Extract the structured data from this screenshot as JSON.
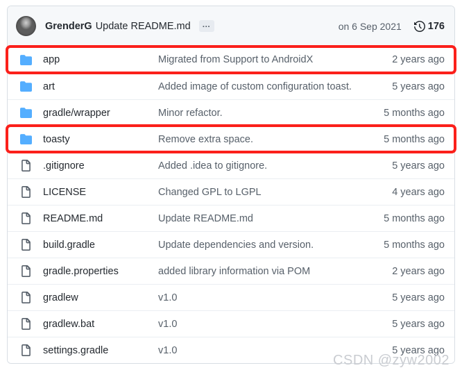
{
  "header": {
    "avatar_name": "avatar",
    "author": "GrenderG",
    "commit_message": "Update README.md",
    "ellipsis_label": "…",
    "date": "on 6 Sep 2021",
    "history_icon": "history-clock-icon",
    "commit_count": "176"
  },
  "rows": [
    {
      "icon": "folder-icon",
      "type": "folder",
      "name": "app",
      "message": "Migrated from Support to AndroidX",
      "time": "2 years ago"
    },
    {
      "icon": "folder-icon",
      "type": "folder",
      "name": "art",
      "message": "Added image of custom configuration toast.",
      "time": "5 years ago"
    },
    {
      "icon": "folder-icon",
      "type": "folder",
      "name": "gradle/wrapper",
      "message": "Minor refactor.",
      "time": "5 months ago"
    },
    {
      "icon": "folder-icon",
      "type": "folder",
      "name": "toasty",
      "message": "Remove extra space.",
      "time": "5 months ago"
    },
    {
      "icon": "file-icon",
      "type": "file",
      "name": ".gitignore",
      "message": "Added .idea to gitignore.",
      "time": "5 years ago"
    },
    {
      "icon": "file-icon",
      "type": "file",
      "name": "LICENSE",
      "message": "Changed GPL to LGPL",
      "time": "4 years ago"
    },
    {
      "icon": "file-icon",
      "type": "file",
      "name": "README.md",
      "message": "Update README.md",
      "time": "5 months ago"
    },
    {
      "icon": "file-icon",
      "type": "file",
      "name": "build.gradle",
      "message": "Update dependencies and version.",
      "time": "5 months ago"
    },
    {
      "icon": "file-icon",
      "type": "file",
      "name": "gradle.properties",
      "message": "added library information via POM",
      "time": "2 years ago"
    },
    {
      "icon": "file-icon",
      "type": "file",
      "name": "gradlew",
      "message": "v1.0",
      "time": "5 years ago"
    },
    {
      "icon": "file-icon",
      "type": "file",
      "name": "gradlew.bat",
      "message": "v1.0",
      "time": "5 years ago"
    },
    {
      "icon": "file-icon",
      "type": "file",
      "name": "settings.gradle",
      "message": "v1.0",
      "time": "5 years ago"
    }
  ],
  "annotations": [
    {
      "target": "app",
      "color": "#fb201b"
    },
    {
      "target": "toasty",
      "color": "#fb201b"
    }
  ],
  "watermark": {
    "text": "CSDN @zyw2002"
  },
  "colors": {
    "folder_blue": "#54aeff",
    "highlight_red": "#fb201b",
    "header_bg": "#f6f8fa",
    "border": "#d8dee4",
    "text_primary": "#24292f",
    "text_secondary": "#57606a"
  }
}
